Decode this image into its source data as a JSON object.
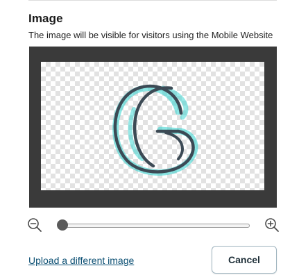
{
  "image_section": {
    "title": "Image",
    "description": "The image will be visible for visitors using the Mobile Website"
  },
  "editor": {
    "frame_color": "#3a3a3a",
    "logo": {
      "letter": "G",
      "stroke_color": "#3c4a55",
      "accent_color": "#2fd4cf"
    }
  },
  "zoom": {
    "out_icon": "zoom-out-icon",
    "in_icon": "zoom-in-icon",
    "level": 0
  },
  "actions": {
    "upload_link": "Upload a different image",
    "cancel_label": "Cancel"
  }
}
